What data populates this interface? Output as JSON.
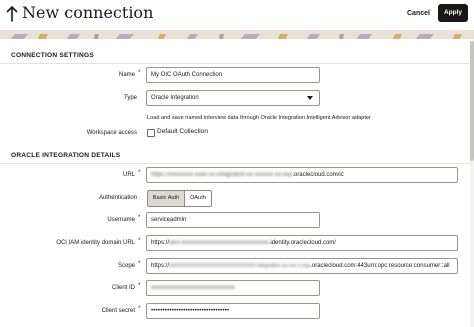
{
  "header": {
    "title": "New connection",
    "cancel_label": "Cancel",
    "apply_label": "Apply"
  },
  "connection_settings": {
    "heading": "CONNECTION SETTINGS",
    "name": {
      "label": "Name",
      "required_mark": "*",
      "value": "My OIC OAuth Connection"
    },
    "type": {
      "label": "Type",
      "value": "Oracle Integration"
    },
    "help_text": "Load and save named interview data through Oracle Integration Intelligent Advisor adapter",
    "workspace_access": {
      "label": "Workspace access",
      "checkbox_label": "Default Collection"
    }
  },
  "oracle_integration_details": {
    "heading": "ORACLE INTEGRATION DETAILS",
    "url": {
      "label": "URL",
      "required_mark": "*",
      "value_masked": "https://xxxxxxxx-xxxx-xx-integration-xx-xxxxxx-xx.ocp",
      "value_suffix": ".oraclecloud.com/ic"
    },
    "authentication": {
      "label": "Authentication",
      "options": [
        "Basic Auth",
        "OAuth"
      ],
      "selected": "Basic Auth"
    },
    "username": {
      "label": "Username",
      "required_mark": "*",
      "value": "serviceadmin"
    },
    "oci_iam_url": {
      "label": "OCI IAM identity domain URL",
      "required_mark": "*",
      "value_prefix": "https://",
      "value_masked": "idcs-xxxxxxxxxxxxxxxxxxxxxxxxxxxxx",
      "value_suffix": ".identity.oraclecloud.com/"
    },
    "scope": {
      "label": "Scope",
      "required_mark": "*",
      "value_prefix": "https://",
      "value_masked": "XXXXXXXXXXXXXXXXXXXXXXXXXX.integration.us-xxx-1.ocp",
      "value_suffix": ".oraclecloud.com:443urn:opc:resource:consumer::all"
    },
    "client_id": {
      "label": "Client ID",
      "required_mark": "*",
      "value_masked": "xxxxxxxxxxxxxxxxxxxxxxxxxxxx"
    },
    "client_secret": {
      "label": "Client secret",
      "required_mark": "*",
      "value": "••••••••••••••••••••••••••••••••••"
    }
  },
  "colors": {
    "apply_bg": "#1a1816",
    "banner_bg": "#e8e1d6",
    "segment_selected_bg": "#ddd9d3",
    "border": "#9a958f"
  },
  "icons": {
    "back": "arrow-up-icon",
    "select": "chevron-down-icon"
  }
}
